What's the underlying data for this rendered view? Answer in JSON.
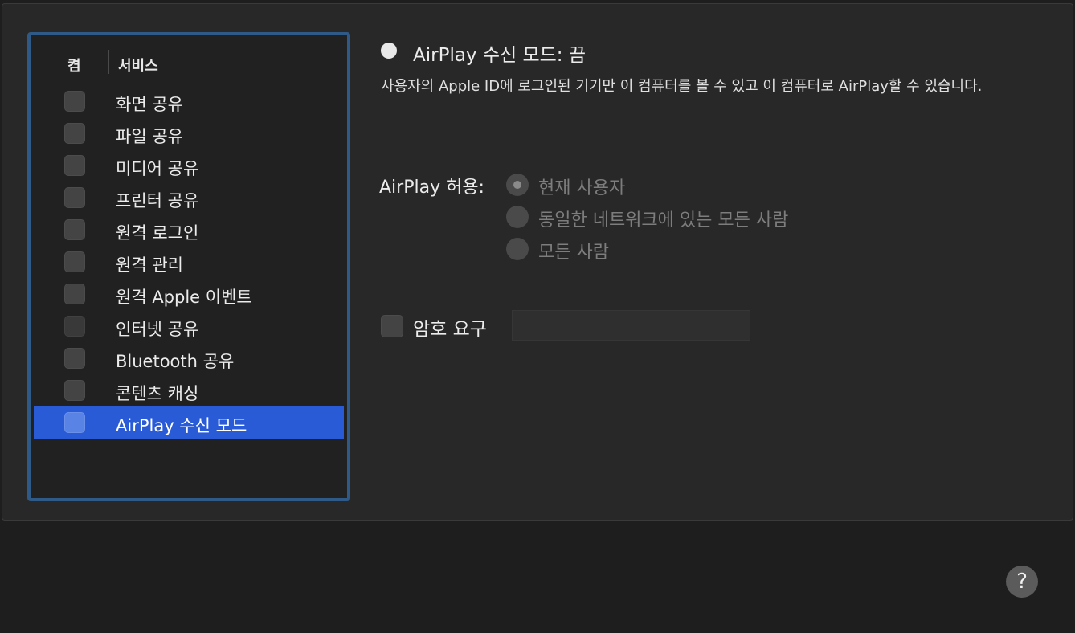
{
  "services_list": {
    "header_on": "켬",
    "header_service": "서비스",
    "items": [
      {
        "label": "화면 공유",
        "checked": false
      },
      {
        "label": "파일 공유",
        "checked": false
      },
      {
        "label": "미디어 공유",
        "checked": false
      },
      {
        "label": "프린터 공유",
        "checked": false
      },
      {
        "label": "원격 로그인",
        "checked": false
      },
      {
        "label": "원격 관리",
        "checked": false
      },
      {
        "label": "원격 Apple 이벤트",
        "checked": false
      },
      {
        "label": "인터넷 공유",
        "checked": false
      },
      {
        "label": "Bluetooth 공유",
        "checked": false
      },
      {
        "label": "콘텐츠 캐싱",
        "checked": false
      },
      {
        "label": "AirPlay 수신 모드",
        "checked": false,
        "selected": true
      }
    ]
  },
  "detail": {
    "status_title": "AirPlay 수신 모드: 끔",
    "status_description": "사용자의 Apple ID에 로그인된 기기만 이 컴퓨터를 볼 수 있고 이 컴퓨터로 AirPlay할 수 있습니다.",
    "allow_label": "AirPlay 허용:",
    "allow_options": [
      {
        "label": "현재 사용자",
        "selected": true
      },
      {
        "label": "동일한 네트워크에 있는 모든 사람",
        "selected": false
      },
      {
        "label": "모든 사람",
        "selected": false
      }
    ],
    "require_password_label": "암호 요구",
    "require_password_checked": false,
    "password_value": ""
  },
  "help_button": "?",
  "colors": {
    "selection": "#2a5bd7",
    "list_border": "#2f5a87",
    "panel_bg": "#282828"
  }
}
